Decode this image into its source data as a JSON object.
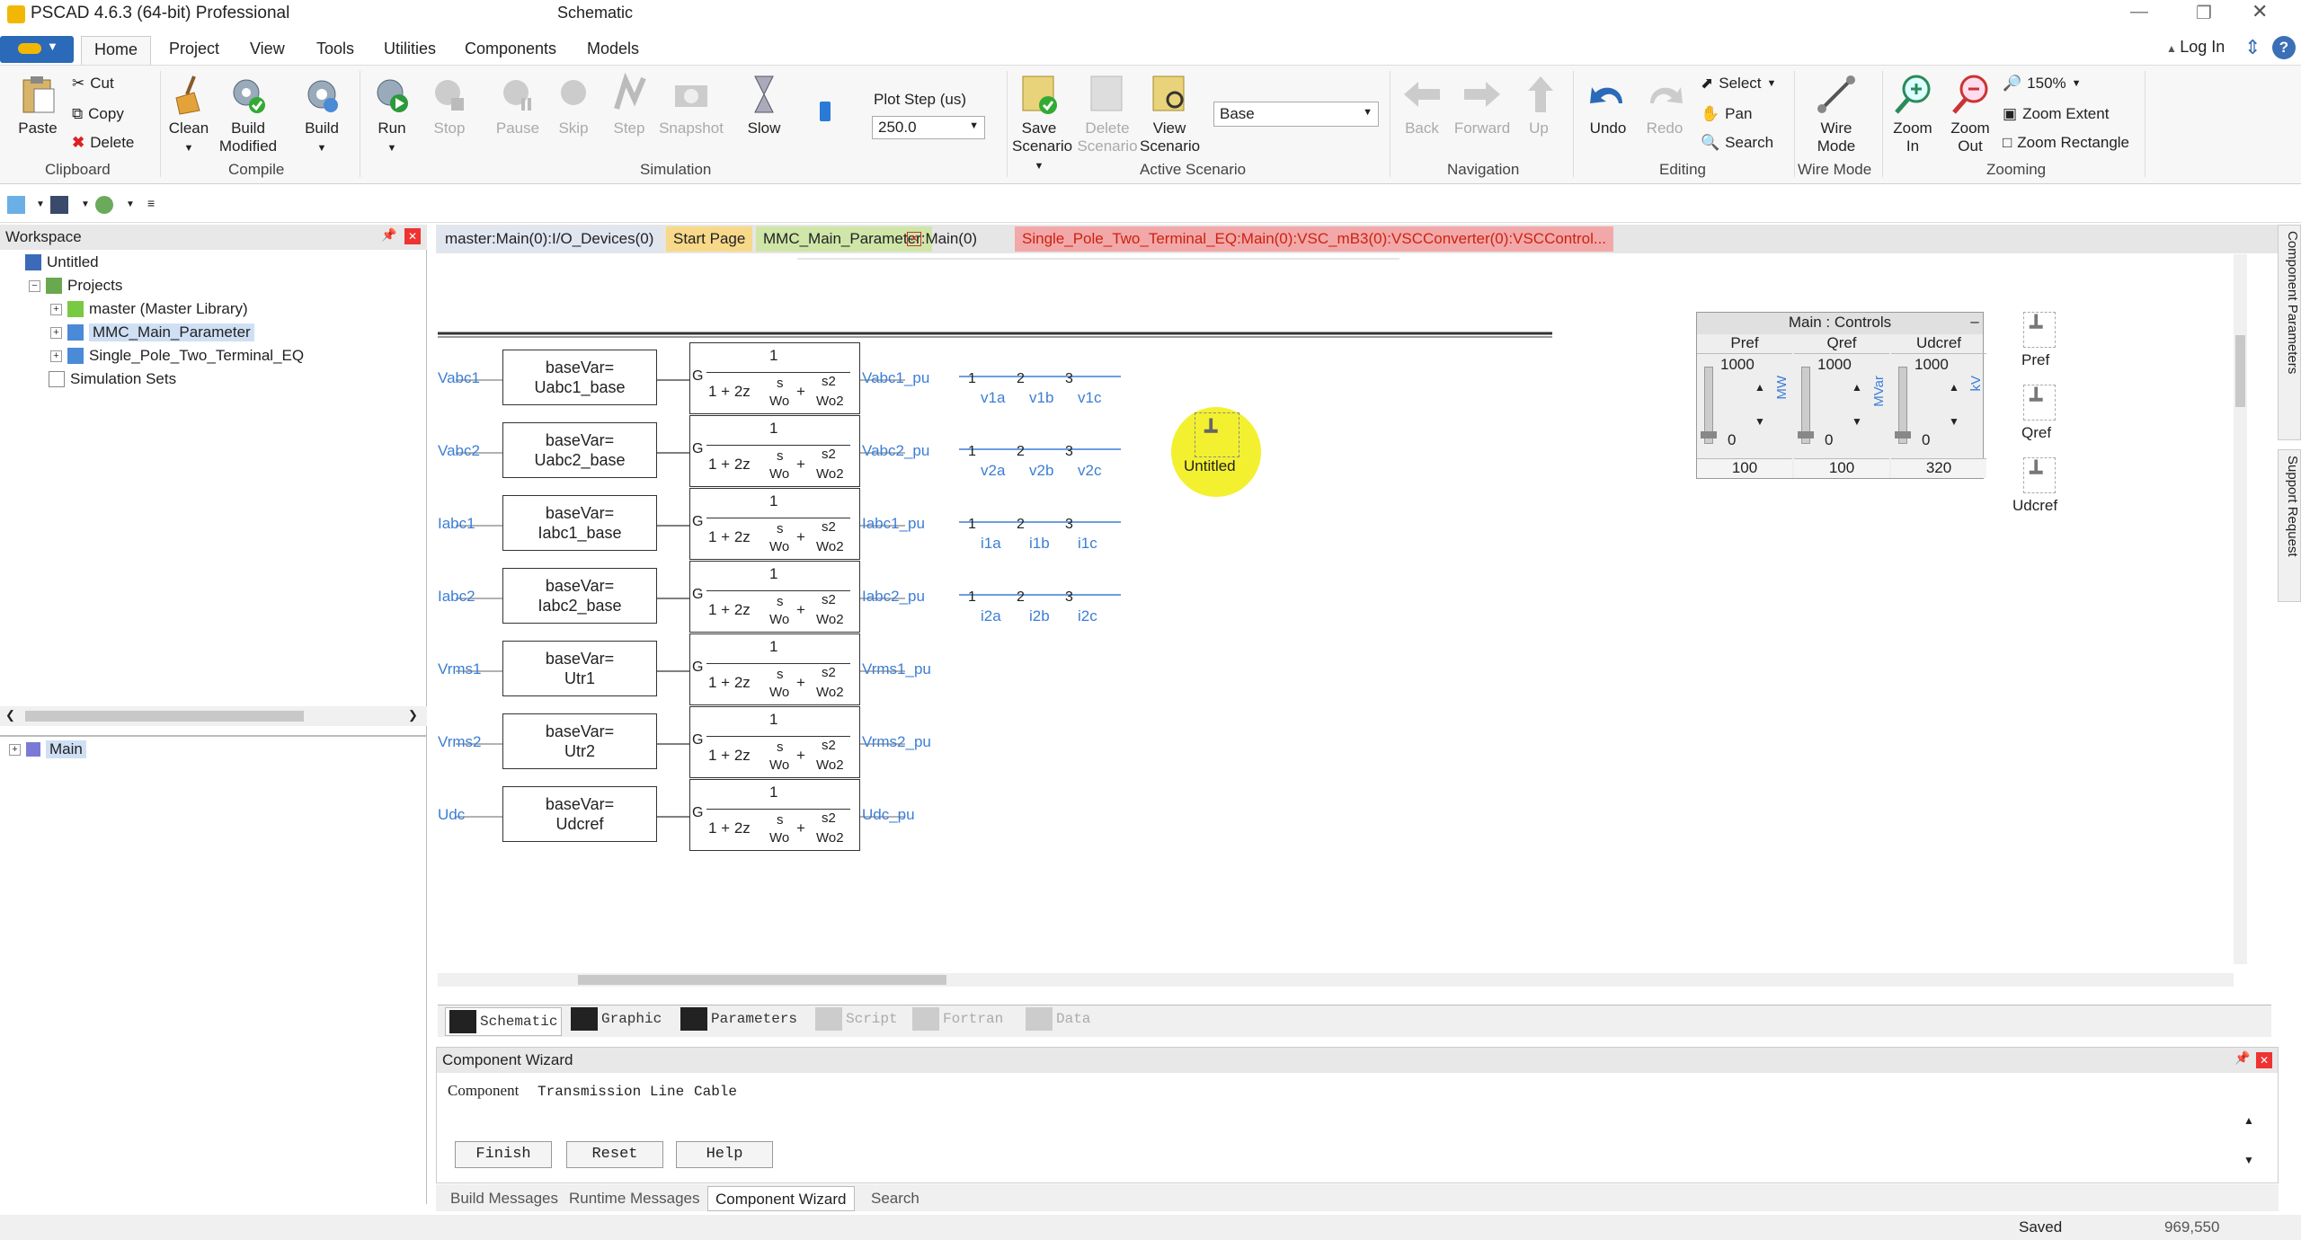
{
  "window": {
    "title": "PSCAD 4.6.3 (64-bit) Professional",
    "doc_title": "Schematic"
  },
  "ribbon_tabs": [
    "Home",
    "Project",
    "View",
    "Tools",
    "Utilities",
    "Components",
    "Models"
  ],
  "login": "Log In",
  "clipboard": {
    "paste": "Paste",
    "cut": "Cut",
    "copy": "Copy",
    "delete": "Delete",
    "group": "Clipboard"
  },
  "compile": {
    "clean": "Clean",
    "build_modified": [
      "Build",
      "Modified"
    ],
    "build": "Build",
    "group": "Compile"
  },
  "simulation": {
    "run": "Run",
    "stop": "Stop",
    "pause": "Pause",
    "skip": "Skip",
    "step": "Step",
    "snapshot": "Snapshot",
    "slow": "Slow",
    "plot_step_label": "Plot Step (us)",
    "plot_step_value": "250.0",
    "group": "Simulation"
  },
  "scenario": {
    "save": [
      "Save",
      "Scenario"
    ],
    "delete": [
      "Delete",
      "Scenario"
    ],
    "view": [
      "View",
      "Scenario"
    ],
    "select_value": "Base",
    "group": "Active Scenario"
  },
  "navigation": {
    "back": "Back",
    "forward": "Forward",
    "up": "Up",
    "group": "Navigation"
  },
  "editing": {
    "undo": "Undo",
    "redo": "Redo",
    "select": "Select",
    "pan": "Pan",
    "search": "Search",
    "group": "Editing"
  },
  "wiremode": {
    "label": [
      "Wire",
      "Mode"
    ],
    "group": "Wire Mode"
  },
  "zooming": {
    "zoom_in": [
      "Zoom",
      "In"
    ],
    "zoom_out": [
      "Zoom",
      "Out"
    ],
    "zoom_pct": "150%",
    "zoom_extent": "Zoom Extent",
    "zoom_rect": "Zoom Rectangle",
    "group": "Zooming"
  },
  "workspace": {
    "title": "Workspace",
    "root": "Untitled",
    "projects": "Projects",
    "items": [
      "master (Master Library)",
      "MMC_Main_Parameter",
      "Single_Pole_Two_Terminal_EQ"
    ],
    "sim_sets": "Simulation Sets",
    "bottom_item": "Main"
  },
  "doc_tabs": [
    "master:Main(0):I/O_Devices(0)",
    "Start Page",
    "MMC_Main_Parameter:Main(0)",
    "Single_Pole_Two_Terminal_EQ:Main(0):VSC_mB3(0):VSCConverter(0):VSCControl..."
  ],
  "schematic": {
    "rows": [
      {
        "in": "Vabc1",
        "base": [
          "baseVar=",
          "Uabc1_base"
        ],
        "out": "Vabc1_pu",
        "split": [
          "v1a",
          "v1b",
          "v1c"
        ]
      },
      {
        "in": "Vabc2",
        "base": [
          "baseVar=",
          "Uabc2_base"
        ],
        "out": "Vabc2_pu",
        "split": [
          "v2a",
          "v2b",
          "v2c"
        ]
      },
      {
        "in": "Iabc1",
        "base": [
          "baseVar=",
          "Iabc1_base"
        ],
        "out": "Iabc1_pu",
        "split": [
          "i1a",
          "i1b",
          "i1c"
        ]
      },
      {
        "in": "Iabc2",
        "base": [
          "baseVar=",
          "Iabc2_base"
        ],
        "out": "Iabc2_pu",
        "split": [
          "i2a",
          "i2b",
          "i2c"
        ]
      },
      {
        "in": "Vrms1",
        "base": [
          "baseVar=",
          "Utr1"
        ],
        "out": "Vrms1_pu",
        "split": []
      },
      {
        "in": "Vrms2",
        "base": [
          "baseVar=",
          "Utr2"
        ],
        "out": "Vrms2_pu",
        "split": []
      },
      {
        "in": "Udc",
        "base": [
          "baseVar=",
          "Udcref"
        ],
        "out": "Udc_pu",
        "split": []
      }
    ],
    "tf": {
      "gain": "G",
      "num": "1",
      "den_prefix": "1 + 2z",
      "s": "s",
      "wo": "Wo",
      "s2": "s2",
      "wo2": "Wo2"
    },
    "split_nums": [
      "1",
      "2",
      "3"
    ],
    "untitled": "Untitled",
    "controls": {
      "title": "Main : Controls",
      "min_btn": "–",
      "sliders": [
        {
          "name": "Pref",
          "max": "1000",
          "min": "0",
          "unit": "MW",
          "value": "100"
        },
        {
          "name": "Qref",
          "max": "1000",
          "min": "0",
          "unit": "MVar",
          "value": "100"
        },
        {
          "name": "Udcref",
          "max": "1000",
          "min": "0",
          "unit": "kV",
          "value": "320"
        }
      ]
    },
    "side_sliders": [
      "Pref",
      "Qref",
      "Udcref"
    ]
  },
  "bottom_tabs": [
    "Schematic",
    "Graphic",
    "Parameters",
    "Script",
    "Fortran",
    "Data"
  ],
  "wizard": {
    "title": "Component Wizard",
    "tabs": [
      "Component",
      "Transmission Line",
      "Cable"
    ],
    "buttons": [
      "Finish",
      "Reset",
      "Help"
    ]
  },
  "msg_tabs": [
    "Build Messages",
    "Runtime Messages",
    "Component Wizard",
    "Search"
  ],
  "side_panels": [
    "Component Parameters",
    "Support Request"
  ],
  "status": {
    "text": "Saved",
    "coords": "969,550"
  }
}
